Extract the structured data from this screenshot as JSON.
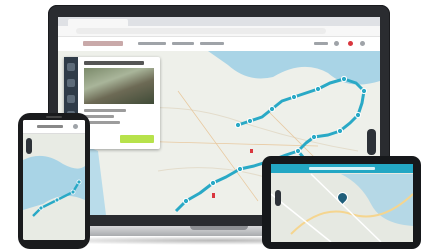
{
  "devices": {
    "laptop": {
      "kind": "laptop",
      "screen_app": "route-planner-website"
    },
    "phone": {
      "kind": "smartphone",
      "screen_app": "route-planner-mobile"
    },
    "tablet": {
      "kind": "navigation-device",
      "screen_app": "navigation-map"
    }
  },
  "colors": {
    "route": "#29a9c6",
    "route_stop": "#29a9c6",
    "accent_button": "#b7e24b",
    "panel_rail": "#2f3b48",
    "marker_red": "#d9363e",
    "water": "#a9d4e6",
    "land": "#eef0ea"
  },
  "icons": [
    "map-pin-icon",
    "zoom-control-icon",
    "layer-icon",
    "menu-icon",
    "close-icon"
  ]
}
